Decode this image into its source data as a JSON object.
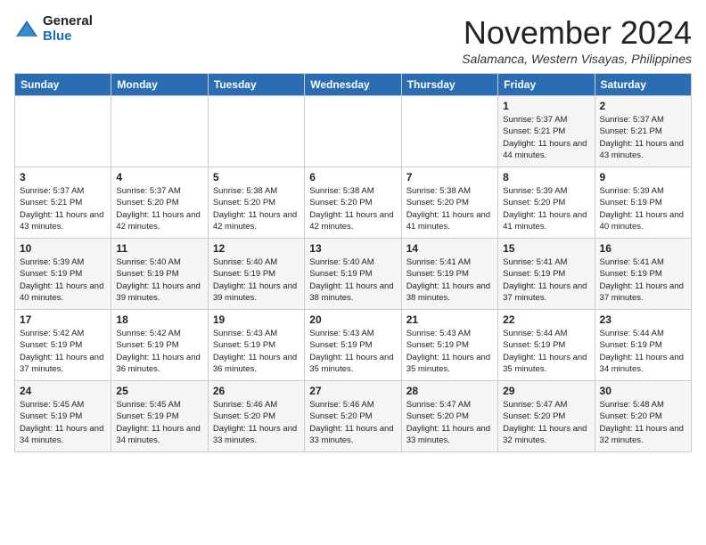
{
  "logo": {
    "general": "General",
    "blue": "Blue"
  },
  "header": {
    "month": "November 2024",
    "location": "Salamanca, Western Visayas, Philippines"
  },
  "weekdays": [
    "Sunday",
    "Monday",
    "Tuesday",
    "Wednesday",
    "Thursday",
    "Friday",
    "Saturday"
  ],
  "weeks": [
    [
      {
        "day": "",
        "info": ""
      },
      {
        "day": "",
        "info": ""
      },
      {
        "day": "",
        "info": ""
      },
      {
        "day": "",
        "info": ""
      },
      {
        "day": "",
        "info": ""
      },
      {
        "day": "1",
        "info": "Sunrise: 5:37 AM\nSunset: 5:21 PM\nDaylight: 11 hours and 44 minutes."
      },
      {
        "day": "2",
        "info": "Sunrise: 5:37 AM\nSunset: 5:21 PM\nDaylight: 11 hours and 43 minutes."
      }
    ],
    [
      {
        "day": "3",
        "info": "Sunrise: 5:37 AM\nSunset: 5:21 PM\nDaylight: 11 hours and 43 minutes."
      },
      {
        "day": "4",
        "info": "Sunrise: 5:37 AM\nSunset: 5:20 PM\nDaylight: 11 hours and 42 minutes."
      },
      {
        "day": "5",
        "info": "Sunrise: 5:38 AM\nSunset: 5:20 PM\nDaylight: 11 hours and 42 minutes."
      },
      {
        "day": "6",
        "info": "Sunrise: 5:38 AM\nSunset: 5:20 PM\nDaylight: 11 hours and 42 minutes."
      },
      {
        "day": "7",
        "info": "Sunrise: 5:38 AM\nSunset: 5:20 PM\nDaylight: 11 hours and 41 minutes."
      },
      {
        "day": "8",
        "info": "Sunrise: 5:39 AM\nSunset: 5:20 PM\nDaylight: 11 hours and 41 minutes."
      },
      {
        "day": "9",
        "info": "Sunrise: 5:39 AM\nSunset: 5:19 PM\nDaylight: 11 hours and 40 minutes."
      }
    ],
    [
      {
        "day": "10",
        "info": "Sunrise: 5:39 AM\nSunset: 5:19 PM\nDaylight: 11 hours and 40 minutes."
      },
      {
        "day": "11",
        "info": "Sunrise: 5:40 AM\nSunset: 5:19 PM\nDaylight: 11 hours and 39 minutes."
      },
      {
        "day": "12",
        "info": "Sunrise: 5:40 AM\nSunset: 5:19 PM\nDaylight: 11 hours and 39 minutes."
      },
      {
        "day": "13",
        "info": "Sunrise: 5:40 AM\nSunset: 5:19 PM\nDaylight: 11 hours and 38 minutes."
      },
      {
        "day": "14",
        "info": "Sunrise: 5:41 AM\nSunset: 5:19 PM\nDaylight: 11 hours and 38 minutes."
      },
      {
        "day": "15",
        "info": "Sunrise: 5:41 AM\nSunset: 5:19 PM\nDaylight: 11 hours and 37 minutes."
      },
      {
        "day": "16",
        "info": "Sunrise: 5:41 AM\nSunset: 5:19 PM\nDaylight: 11 hours and 37 minutes."
      }
    ],
    [
      {
        "day": "17",
        "info": "Sunrise: 5:42 AM\nSunset: 5:19 PM\nDaylight: 11 hours and 37 minutes."
      },
      {
        "day": "18",
        "info": "Sunrise: 5:42 AM\nSunset: 5:19 PM\nDaylight: 11 hours and 36 minutes."
      },
      {
        "day": "19",
        "info": "Sunrise: 5:43 AM\nSunset: 5:19 PM\nDaylight: 11 hours and 36 minutes."
      },
      {
        "day": "20",
        "info": "Sunrise: 5:43 AM\nSunset: 5:19 PM\nDaylight: 11 hours and 35 minutes."
      },
      {
        "day": "21",
        "info": "Sunrise: 5:43 AM\nSunset: 5:19 PM\nDaylight: 11 hours and 35 minutes."
      },
      {
        "day": "22",
        "info": "Sunrise: 5:44 AM\nSunset: 5:19 PM\nDaylight: 11 hours and 35 minutes."
      },
      {
        "day": "23",
        "info": "Sunrise: 5:44 AM\nSunset: 5:19 PM\nDaylight: 11 hours and 34 minutes."
      }
    ],
    [
      {
        "day": "24",
        "info": "Sunrise: 5:45 AM\nSunset: 5:19 PM\nDaylight: 11 hours and 34 minutes."
      },
      {
        "day": "25",
        "info": "Sunrise: 5:45 AM\nSunset: 5:19 PM\nDaylight: 11 hours and 34 minutes."
      },
      {
        "day": "26",
        "info": "Sunrise: 5:46 AM\nSunset: 5:20 PM\nDaylight: 11 hours and 33 minutes."
      },
      {
        "day": "27",
        "info": "Sunrise: 5:46 AM\nSunset: 5:20 PM\nDaylight: 11 hours and 33 minutes."
      },
      {
        "day": "28",
        "info": "Sunrise: 5:47 AM\nSunset: 5:20 PM\nDaylight: 11 hours and 33 minutes."
      },
      {
        "day": "29",
        "info": "Sunrise: 5:47 AM\nSunset: 5:20 PM\nDaylight: 11 hours and 32 minutes."
      },
      {
        "day": "30",
        "info": "Sunrise: 5:48 AM\nSunset: 5:20 PM\nDaylight: 11 hours and 32 minutes."
      }
    ]
  ]
}
